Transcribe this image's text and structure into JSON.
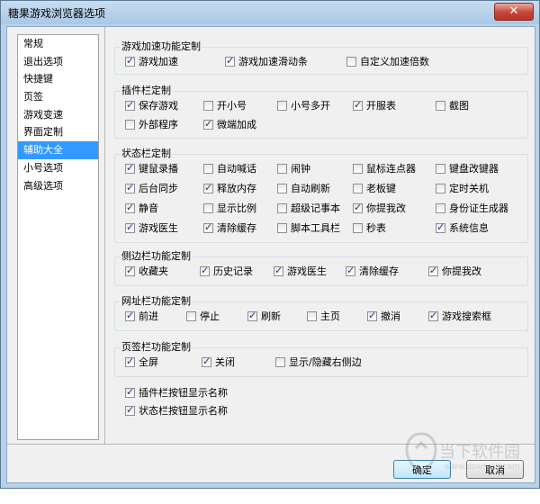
{
  "window": {
    "title": "糖果游戏浏览器选项",
    "close_label": "✕"
  },
  "sidebar": {
    "items": [
      "常规",
      "退出选项",
      "快捷键",
      "页签",
      "游戏变速",
      "界面定制",
      "辅助大全",
      "小号选项",
      "高级选项"
    ],
    "selected_index": 6
  },
  "groups": {
    "speed": {
      "title": "游戏加速功能定制",
      "items": [
        {
          "label": "游戏加速",
          "checked": true
        },
        {
          "label": "游戏加速滑动条",
          "checked": true
        },
        {
          "label": "自定义加速倍数",
          "checked": false
        }
      ]
    },
    "plugin": {
      "title": "插件栏定制",
      "items": [
        {
          "label": "保存游戏",
          "checked": true
        },
        {
          "label": "开小号",
          "checked": false
        },
        {
          "label": "小号多开",
          "checked": false
        },
        {
          "label": "开服表",
          "checked": true
        },
        {
          "label": "截图",
          "checked": false
        },
        {
          "label": "外部程序",
          "checked": false
        },
        {
          "label": "微端加成",
          "checked": true
        }
      ]
    },
    "status": {
      "title": "状态栏定制",
      "items": [
        {
          "label": "键鼠录播",
          "checked": true
        },
        {
          "label": "自动喊话",
          "checked": false
        },
        {
          "label": "闹钟",
          "checked": false
        },
        {
          "label": "鼠标连点器",
          "checked": false
        },
        {
          "label": "键盘改键器",
          "checked": false
        },
        {
          "label": "后台同步",
          "checked": true
        },
        {
          "label": "释放内存",
          "checked": true
        },
        {
          "label": "自动刷新",
          "checked": false
        },
        {
          "label": "老板键",
          "checked": false
        },
        {
          "label": "定时关机",
          "checked": false
        },
        {
          "label": "静音",
          "checked": true
        },
        {
          "label": "显示比例",
          "checked": false
        },
        {
          "label": "超级记事本",
          "checked": false
        },
        {
          "label": "你提我改",
          "checked": true
        },
        {
          "label": "身份证生成器",
          "checked": false
        },
        {
          "label": "游戏医生",
          "checked": true
        },
        {
          "label": "清除缓存",
          "checked": true
        },
        {
          "label": "脚本工具栏",
          "checked": false
        },
        {
          "label": "秒表",
          "checked": false
        },
        {
          "label": "系统信息",
          "checked": true
        }
      ]
    },
    "side": {
      "title": "侧边栏功能定制",
      "items": [
        {
          "label": "收藏夹",
          "checked": true
        },
        {
          "label": "历史记录",
          "checked": true
        },
        {
          "label": "游戏医生",
          "checked": true
        },
        {
          "label": "清除缓存",
          "checked": true
        },
        {
          "label": "你提我改",
          "checked": true
        }
      ]
    },
    "address": {
      "title": "网址栏功能定制",
      "items": [
        {
          "label": "前进",
          "checked": true
        },
        {
          "label": "停止",
          "checked": false
        },
        {
          "label": "刷新",
          "checked": true
        },
        {
          "label": "主页",
          "checked": false
        },
        {
          "label": "撤消",
          "checked": true
        },
        {
          "label": "游戏搜索框",
          "checked": true
        }
      ]
    },
    "tabs": {
      "title": "页签栏功能定制",
      "items": [
        {
          "label": "全屏",
          "checked": true
        },
        {
          "label": "关闭",
          "checked": true
        },
        {
          "label": "显示/隐藏右侧边",
          "checked": false
        }
      ]
    }
  },
  "standalone": [
    {
      "label": "插件栏按钮显示名称",
      "checked": true
    },
    {
      "label": "状态栏按钮显示名称",
      "checked": true
    }
  ],
  "buttons": {
    "ok": "确定",
    "cancel": "取消"
  },
  "watermark": {
    "brand": "当下软件园",
    "url": "www.downxia.com"
  },
  "colors": {
    "accent": "#3399ff",
    "check": "#1f3b78"
  }
}
